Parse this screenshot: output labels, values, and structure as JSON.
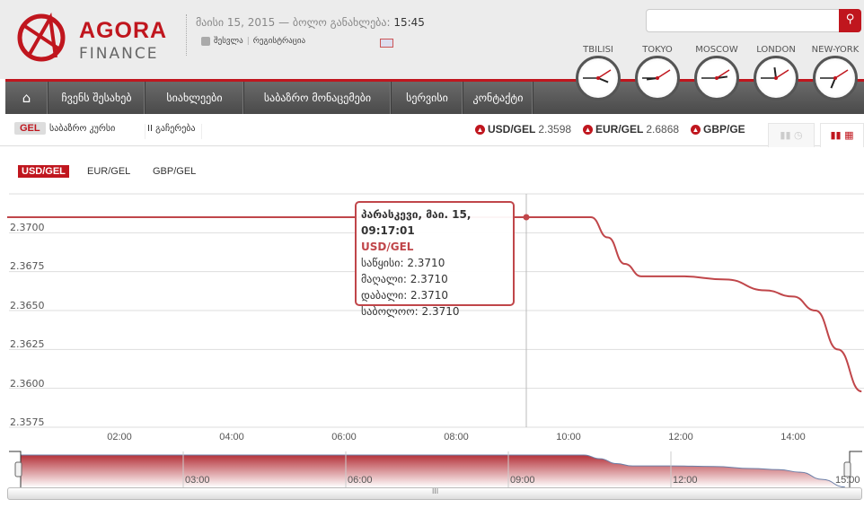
{
  "brand": {
    "name": "AGORA",
    "sub": "FINANCE"
  },
  "header": {
    "date": "მაისი 15, 2015 — ბოლო განახლება:",
    "time": "15:45",
    "login": "შესვლა",
    "register": "რეგისტრაცია"
  },
  "nav": [
    {
      "label": ""
    },
    {
      "label": "ჩვენს შესახებ"
    },
    {
      "label": "სიახლეები"
    },
    {
      "label": "საბაზრო მონაცემები"
    },
    {
      "label": "სერვისი"
    },
    {
      "label": "კონტაქტი"
    }
  ],
  "clocks": [
    {
      "city": "TBILISI",
      "h": 15,
      "m": 45
    },
    {
      "city": "TOKYO",
      "h": 20,
      "m": 45
    },
    {
      "city": "MOSCOW",
      "h": 14,
      "m": 45
    },
    {
      "city": "LONDON",
      "h": 11,
      "m": 45
    },
    {
      "city": "NEW-YORK",
      "h": 6,
      "m": 45
    }
  ],
  "subbar": {
    "badge": "GEL",
    "rate_label": "საბაზრო კურსი",
    "pause": "II გაჩერება"
  },
  "tickers": [
    {
      "pair": "USD/GEL",
      "value": "2.3598"
    },
    {
      "pair": "EUR/GEL",
      "value": "2.6868"
    },
    {
      "pair": "GBP/GE",
      "value": ""
    }
  ],
  "pairs": [
    "USD/GEL",
    "EUR/GEL",
    "GBP/GEL"
  ],
  "tooltip": {
    "title": "პარასკევი, მაი. 15, 09:17:01",
    "series": "USD/GEL",
    "open": "საწყისი: 2.3710",
    "high": "მაღალი: 2.3710",
    "low": "დაბალი: 2.3710",
    "close": "საბოლოო: 2.3710"
  },
  "chart_data": {
    "type": "line",
    "series_name": "USD/GEL",
    "ylim": [
      2.3575,
      2.3725
    ],
    "yticks": [
      "2.3700",
      "2.3675",
      "2.3650",
      "2.3625",
      "2.3600",
      "2.3575"
    ],
    "xlim_hours": [
      0,
      15.22
    ],
    "xticks": [
      "02:00",
      "04:00",
      "06:00",
      "08:00",
      "10:00",
      "12:00",
      "14:00"
    ],
    "navigator_ticks": [
      "03:00",
      "06:00",
      "09:00",
      "12:00",
      "15:00"
    ],
    "x_hours": [
      0,
      10.4,
      10.7,
      11.0,
      11.3,
      12.0,
      12.8,
      13.5,
      14.0,
      14.4,
      14.8,
      15.22
    ],
    "values": [
      2.371,
      2.371,
      2.3697,
      2.368,
      2.3672,
      2.3672,
      2.367,
      2.3663,
      2.3659,
      2.365,
      2.3625,
      2.3598
    ]
  }
}
